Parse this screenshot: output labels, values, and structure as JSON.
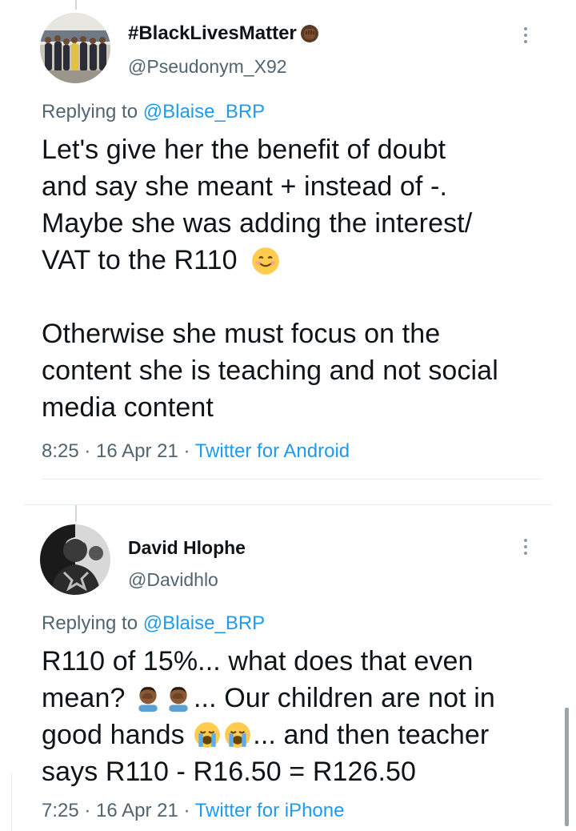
{
  "tweets": [
    {
      "display_name": "#BlackLivesMatter",
      "handle": "@Pseudonym_X92",
      "replying_prefix": "Replying to ",
      "replying_to": "@Blaise_BRP",
      "body_line1": "Let's give her the benefit of doubt",
      "body_line2": "and say she meant + instead of -.",
      "body_line3": "Maybe she was adding the interest/",
      "body_line4": "VAT to the R110",
      "body_line5": "Otherwise she must focus on the",
      "body_line6": "content she is teaching and not social",
      "body_line7": "media content",
      "time": "8:25",
      "date": "16 Apr 21",
      "source": "Twitter for Android",
      "emoji_name": "smiling-face-emoji",
      "badge_name": "raised-fist-emoji"
    },
    {
      "display_name": "David Hlophe",
      "handle": "@Davidhlo",
      "replying_prefix": "Replying to ",
      "replying_to": "@Blaise_BRP",
      "body_line1": "R110 of 15%... what does that even",
      "body_line2a": "mean?",
      "body_line2b": "... Our children are not in",
      "body_line3a": "good hands",
      "body_line3b": "... and then teacher",
      "body_line4": "says R110 - R16.50 = R126.50",
      "time": "7:25",
      "date": "16 Apr 21",
      "source": "Twitter for iPhone",
      "emoji_facepalm": "facepalm-emoji",
      "emoji_crying": "loudly-crying-emoji"
    }
  ],
  "separator": " · ",
  "colors": {
    "link": "#1d9bf0",
    "muted": "#536471",
    "text": "#0f1419"
  }
}
